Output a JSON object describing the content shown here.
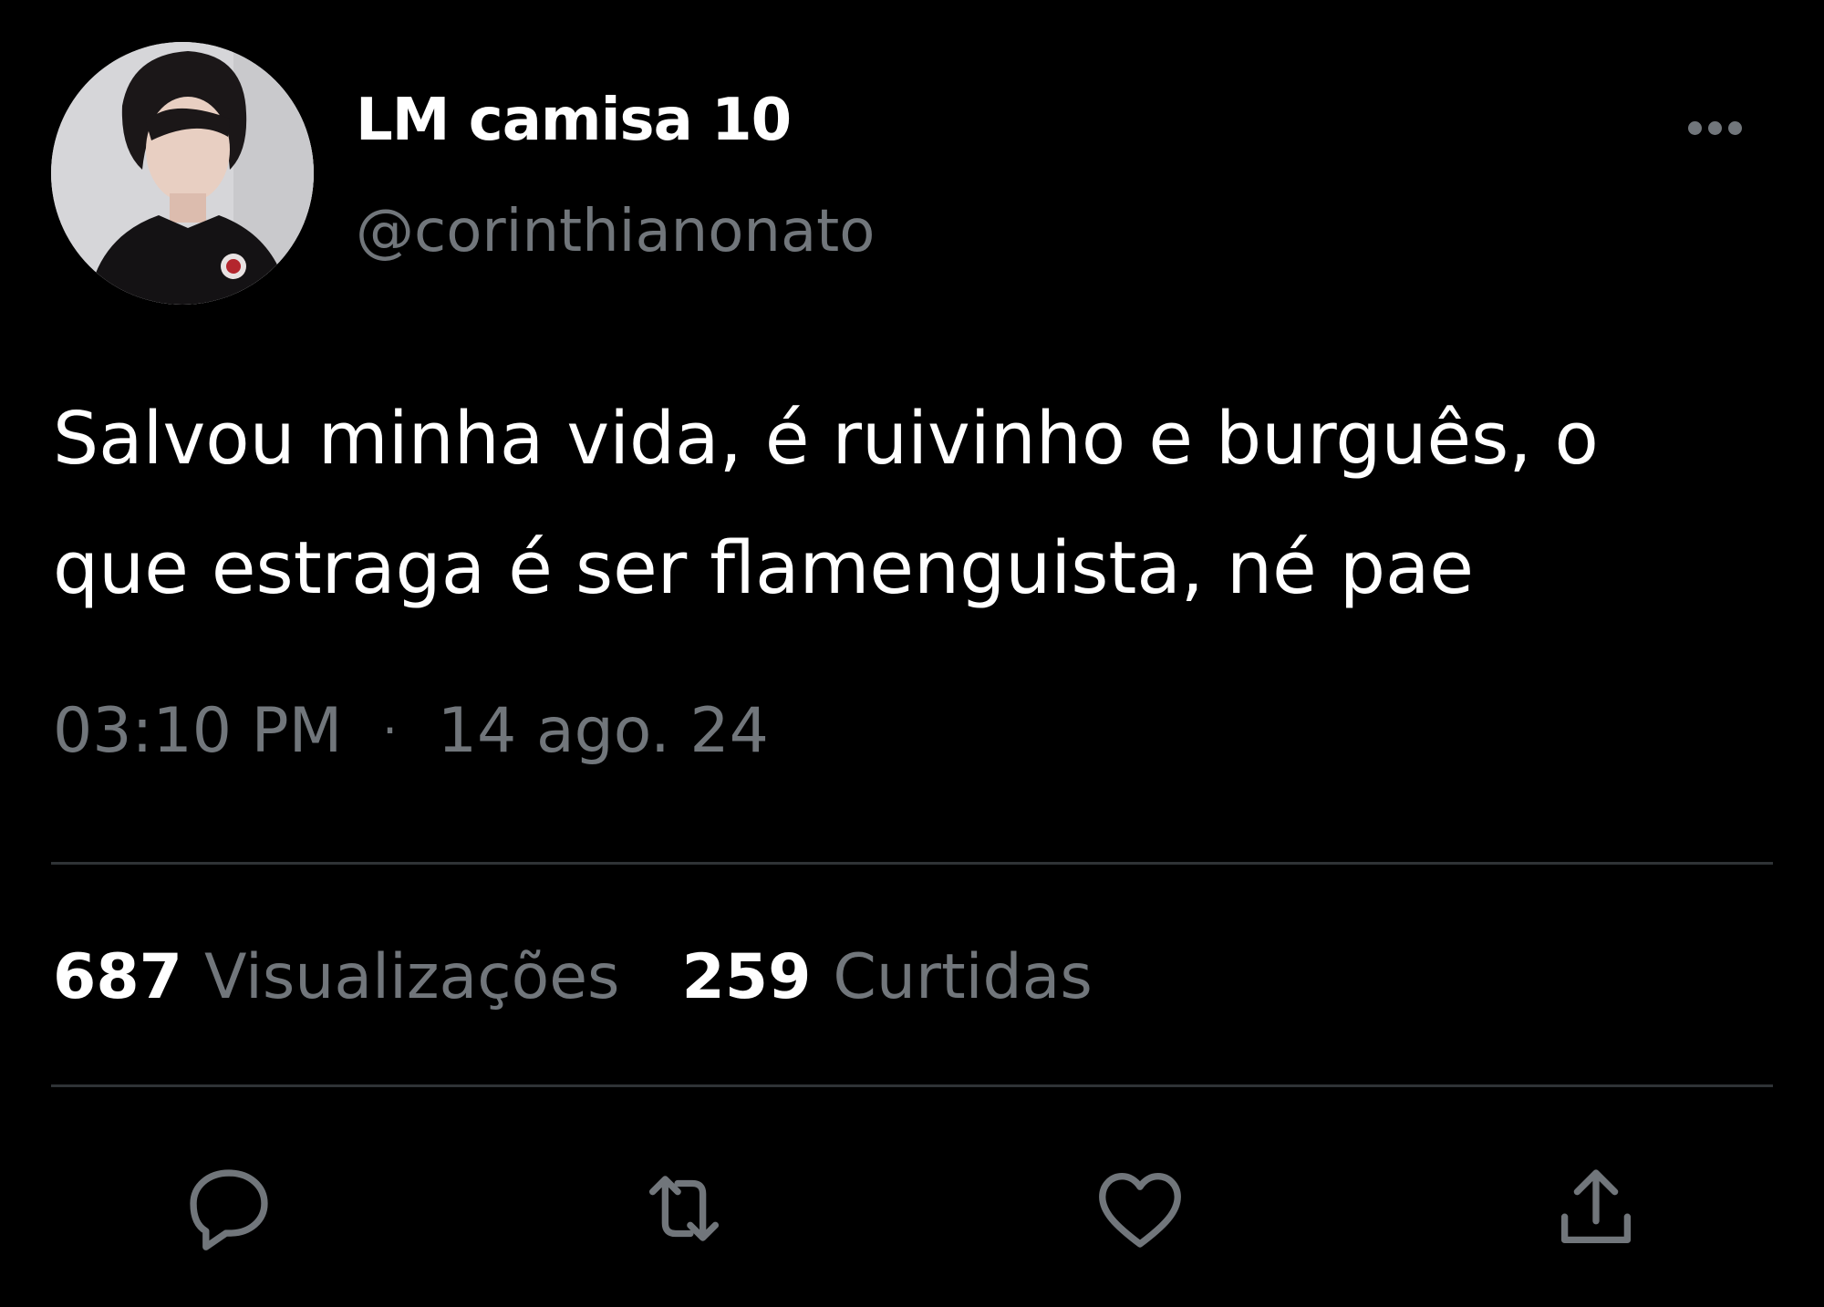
{
  "tweet": {
    "author": {
      "display_name": "LM camisa 10",
      "handle": "@corinthianonato",
      "avatar": "profile-photo"
    },
    "more_icon": "more-horizontal-icon",
    "text": "Salvou minha vida, é ruivinho e burguês, o\nque estraga é ser flamenguista, né pae",
    "time": "03:10 PM",
    "separator": "·",
    "date": "14 ago. 24",
    "stats": {
      "views_count": "687",
      "views_label": "Visualizações",
      "likes_count": "259",
      "likes_label": "Curtidas"
    },
    "actions": [
      {
        "icon": "reply-icon"
      },
      {
        "icon": "retweet-icon"
      },
      {
        "icon": "like-icon"
      },
      {
        "icon": "share-icon"
      }
    ]
  },
  "colors": {
    "background": "#000000",
    "primary_text": "#ffffff",
    "secondary_text": "#71767b",
    "divider": "#2f3336"
  }
}
